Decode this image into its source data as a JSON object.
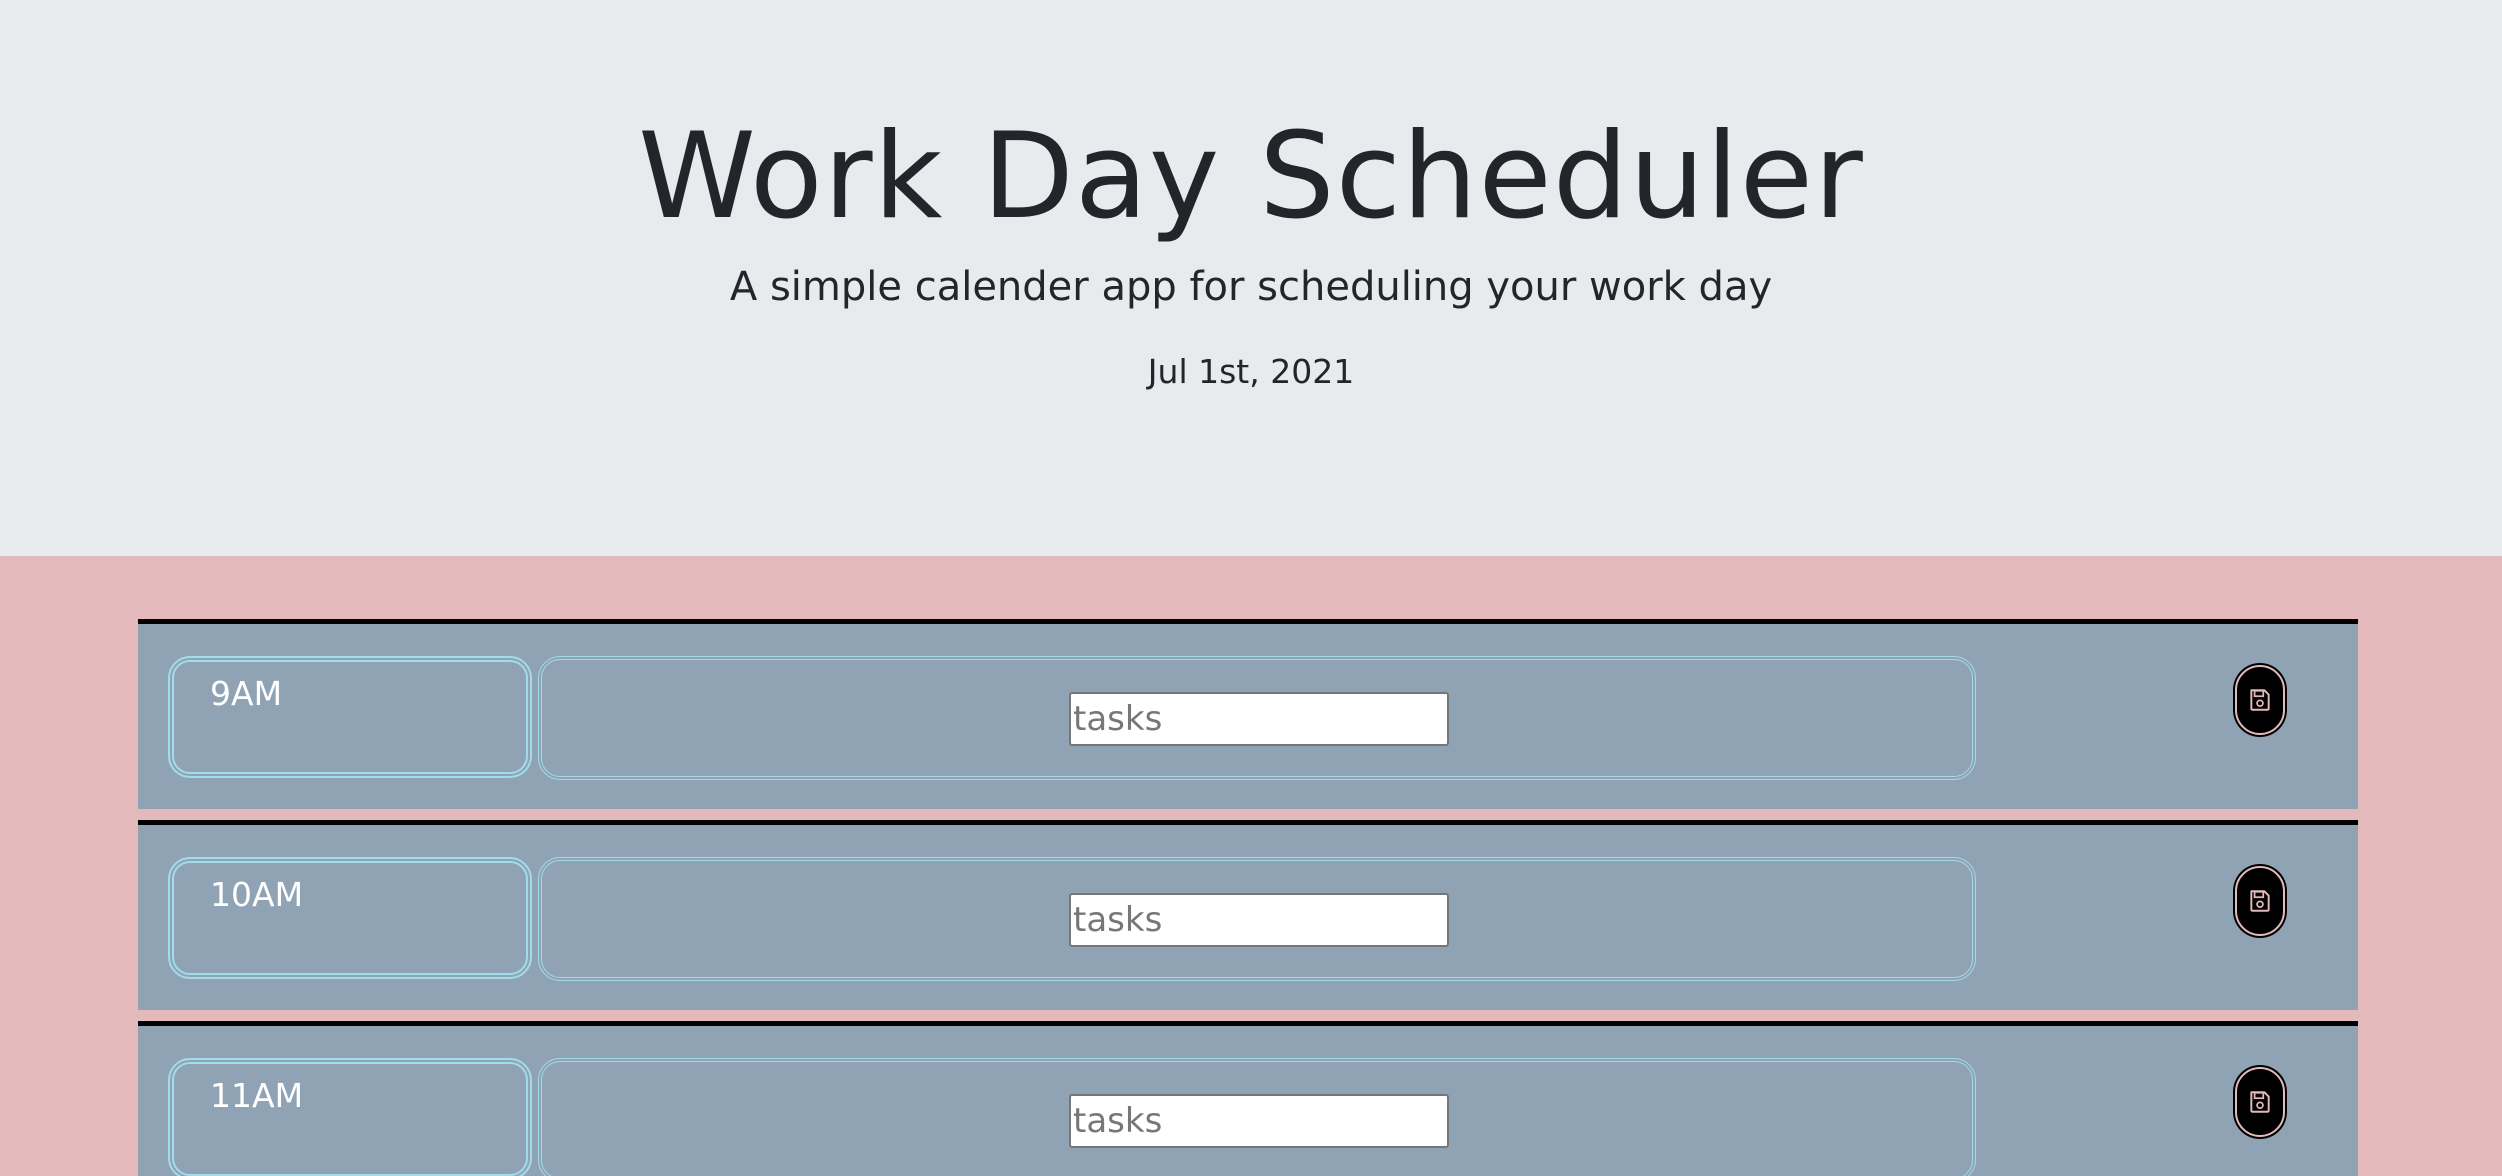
{
  "header": {
    "title": "Work Day Scheduler",
    "subtitle": "A simple calender app for scheduling your work day",
    "date": "Jul 1st, 2021"
  },
  "colors": {
    "header_bg": "#e8ebee",
    "page_bg": "#e4b9bb",
    "row_bg": "#8fa3b5",
    "border_accent": "#a2dbea",
    "save_button_bg": "#000000",
    "save_icon": "#e4b9bb"
  },
  "schedule": {
    "rows": [
      {
        "hour": "9AM",
        "task_value": "",
        "task_placeholder": "tasks",
        "save_icon": "floppy-disk-icon"
      },
      {
        "hour": "10AM",
        "task_value": "",
        "task_placeholder": "tasks",
        "save_icon": "floppy-disk-icon"
      },
      {
        "hour": "11AM",
        "task_value": "",
        "task_placeholder": "tasks",
        "save_icon": "floppy-disk-icon"
      }
    ]
  }
}
